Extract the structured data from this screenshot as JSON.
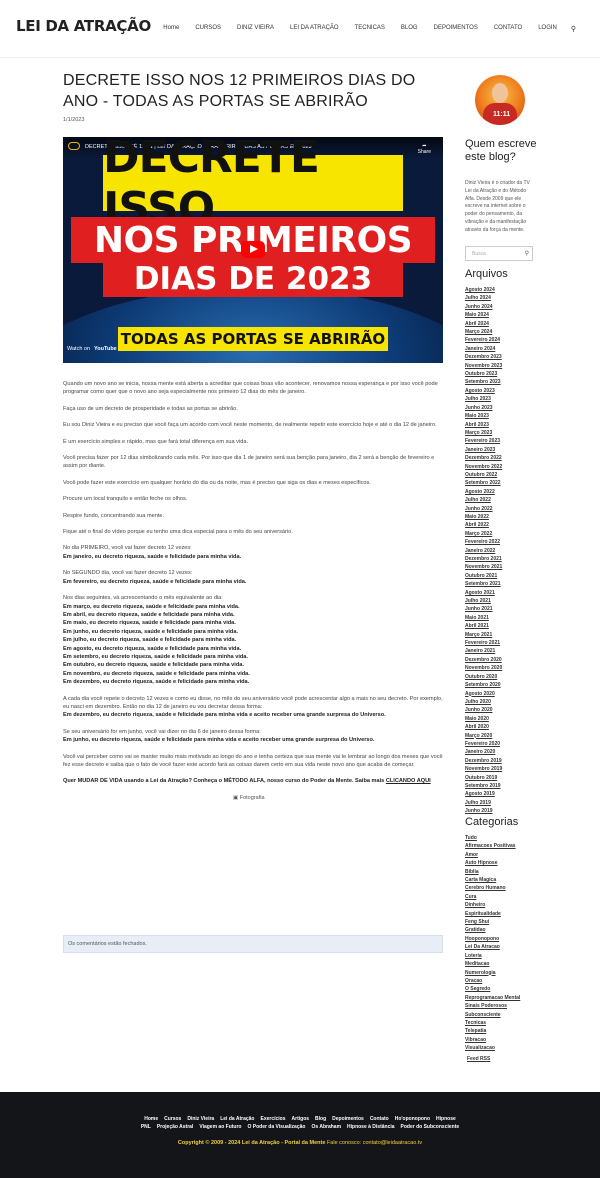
{
  "header": {
    "logo": "LEI DA ATRAÇÃO",
    "nav": [
      "Home",
      "CURSOS",
      "DINIZ VIEIRA",
      "LEI DA ATRAÇÃO",
      "TECNICAS",
      "BLOG",
      "DEPOIMENTOS",
      "CONTATO",
      "LOGIN"
    ]
  },
  "post": {
    "title": "DECRETE ISSO NOS 12 PRIMEIROS DIAS DO ANO - TODAS AS PORTAS SE ABRIRÃO",
    "date": "1/1/2023"
  },
  "video": {
    "title": "DECRETE ISSO ATÉ 12/01 | LEI DA ATRAÇÃO PARA ABRIR TODAS AS PORTAS EM 2023",
    "share": "Share",
    "line1": "DECRETE ISSO",
    "line2": "NOS PRIMEIROS",
    "line3": "DIAS DE 2023",
    "line4": "TODAS AS PORTAS SE ABRIRÃO",
    "watch_on": "Watch on",
    "youtube": "YouTube"
  },
  "content": {
    "p1": "Quando um novo ano se inicia, nossa mente está aberta a acreditar que coisas boas vão acontecer, renovamos nossa esperança e por isso você pode programar como quer que o novo ano seja especialmente nos primeiro 12 dias do mês de janeiro.",
    "p2": "Faça uso de um decreto de prosperidade e todas as portas se abrirão.",
    "p3": "Eu sou Diniz Vieira e eu preciso que você faça um acordo com você neste momento, de realmente repetir este exercício hoje e até o dia 12 de janeiro.",
    "p4": "É um exercício simples e rápido, mas que fará total diferença em sua vida.",
    "p5": "Você precisa fazer por 12 dias simbolizando cada mês. Por isso que dia 1 de janeiro será sua benção para janeiro, dia 2 será a benção de fevereiro e assim por diante.",
    "p6": "Você pode fazer este exercício em qualquer horário do dia ou da noite, mas é preciso que siga os dias e meses específicos.",
    "p7": "Procure um local tranquilo e então feche os olhos.",
    "p8": "Respire fundo, concentrando sua mente.",
    "p9": "Fique até o final do vídeo porque eu tenho uma dica especial para o mês do seu aniversário.",
    "p10a": "No dia PRIMEIRO, você vai fazer decreto 12 vezes:",
    "p10b": "Em janeiro, eu decreto riqueza, saúde e felicidade para minha vida.",
    "p11a": "No SEGUNDO dia, você vai fazer decreto 12 vezes:",
    "p11b": "Em fevereiro, eu decreto riqueza, saúde e felicidade para minha vida.",
    "p12a": "Nos dias seguintes, vá acrescentando o mês equivalente ao dia:",
    "months": [
      "Em março, eu decreto riqueza, saúde e felicidade para minha vida.",
      "Em abril, eu decreto riqueza, saúde e felicidade para minha vida.",
      "Em maio, eu decreto riqueza, saúde e felicidade para minha vida.",
      "Em junho, eu decreto riqueza, saúde e felicidade para minha vida.",
      "Em julho, eu decreto riqueza, saúde e felicidade para minha vida.",
      "Em agosto, eu decreto riqueza, saúde e felicidade para minha vida.",
      "Em setembro, eu decreto riqueza, saúde e felicidade para minha vida.",
      "Em outubro, eu decreto riqueza, saúde e felicidade para minha vida.",
      "Em novembro, eu decreto riqueza, saúde e felicidade para minha vida.",
      "Em dezembro, eu decreto riqueza, saúde e felicidade para minha vida."
    ],
    "p13a": "A cada dia você repete o decreto 12 vezes e como eu disse, no mês do seu aniversário você pode acrescentar algo a mais no seu decreto. Por exemplo, eu nasci em dezembro. Então no dia 12 de janeiro eu vou decretar dessa forma:",
    "p13b": "Em dezembro, eu decreto riqueza, saúde e felicidade para minha vida e aceito receber uma grande surpresa do Universo.",
    "p14a": "Se seu aniversário for em junho, você vai dizer no dia 6 de janeiro dessa forma:",
    "p14b": "Em junho, eu decreto riqueza, saúde e felicidade para minha vida e aceito receber uma grande surpresa do Universo.",
    "p15": "Você vai perceber como vai se manter muito mais motivado ao longo do ano e tenha certeza que sua mente vai te lembrar ao longo dos meses que você fez esse decreto e saiba que o fato de você fazer este acordo fará as coisas darem certo em sua vida neste novo ano que acaba de começar.",
    "cta": "Quer MUDAR DE VIDA usando a Lei da Atração? Conheça o MÉTODO ALFA, nosso curso do Poder da Mente. Saiba mais",
    "cta_link": "CLICANDO AQUI",
    "photo_alt": "Fotografia",
    "comments_closed": "Os comentários estão fechados."
  },
  "sidebar": {
    "avatar_number": "11:11",
    "title": "Quem escreve este blog?",
    "bio": "Diniz Vieira é o criador da TV Lei da Atração e do Método Alfa. Desde 2009 que ele escreve na internet sobre o poder do pensamento, da vibração e da manifestação através da força da mente.",
    "search_placeholder": "Busca",
    "archives_title": "Arquivos",
    "archives": [
      "Agosto 2024",
      "Julho 2024",
      "Junho 2024",
      "Maio 2024",
      "Abril 2024",
      "Março 2024",
      "Fevereiro 2024",
      "Janeiro 2024",
      "Dezembro 2023",
      "Novembro 2023",
      "Outubro 2023",
      "Setembro 2023",
      "Agosto 2023",
      "Julho 2023",
      "Junho 2023",
      "Maio 2023",
      "Abril 2023",
      "Março 2023",
      "Fevereiro 2023",
      "Janeiro 2023",
      "Dezembro 2022",
      "Novembro 2022",
      "Outubro 2022",
      "Setembro 2022",
      "Agosto 2022",
      "Julho 2022",
      "Junho 2022",
      "Maio 2022",
      "Abril 2022",
      "Março 2022",
      "Fevereiro 2022",
      "Janeiro 2022",
      "Dezembro 2021",
      "Novembro 2021",
      "Outubro 2021",
      "Setembro 2021",
      "Agosto 2021",
      "Julho 2021",
      "Junho 2021",
      "Maio 2021",
      "Abril 2021",
      "Março 2021",
      "Fevereiro 2021",
      "Janeiro 2021",
      "Dezembro 2020",
      "Novembro 2020",
      "Outubro 2020",
      "Setembro 2020",
      "Agosto 2020",
      "Julho 2020",
      "Junho 2020",
      "Maio 2020",
      "Abril 2020",
      "Março 2020",
      "Fevereiro 2020",
      "Janeiro 2020",
      "Dezembro 2019",
      "Novembro 2019",
      "Outubro 2019",
      "Setembro 2019",
      "Agosto 2019",
      "Julho 2019",
      "Junho 2019"
    ],
    "categories_title": "Categorias",
    "categories": [
      "Tudo",
      "Afirmacoes Positivas",
      "Amor",
      "Auto Hipnose",
      "Biblia",
      "Carta Magica",
      "Cerebro Humano",
      "Cura",
      "Dinheiro",
      "Espiritualidade",
      "Feng Shui",
      "Gratidao",
      "Hooponopono",
      "Lei Da Atracao",
      "Loteria",
      "Meditacao",
      "Numerologia",
      "Oracao",
      "O Segredo",
      "Reprogramacao Mental",
      "Sinais Poderosos",
      "Subconsciente",
      "Tecnicas",
      "Telepatia",
      "Vibracao",
      "Visualizacao"
    ],
    "feed": "Feed RSS"
  },
  "footer": {
    "row1": [
      "Home",
      "Cursos",
      "Diniz Vieira",
      "Lei da Atração",
      "Exercícios",
      "Artigos",
      "Blog",
      "Depoimentos",
      "Contato",
      "Ho'oponopono",
      "Hipnose"
    ],
    "row2": [
      "PNL",
      "Projeção Astral",
      "Viagem ao Futuro",
      "O Poder da Visualização",
      "Os Abraham",
      "Hipnose à Distância",
      "Poder do Subconsciente"
    ],
    "copyright": "Copyright © 2009 - 2024 Lei da Atração - Portal da Mente",
    "contact": "Fale conosco: contato@leidaatracao.tv"
  }
}
